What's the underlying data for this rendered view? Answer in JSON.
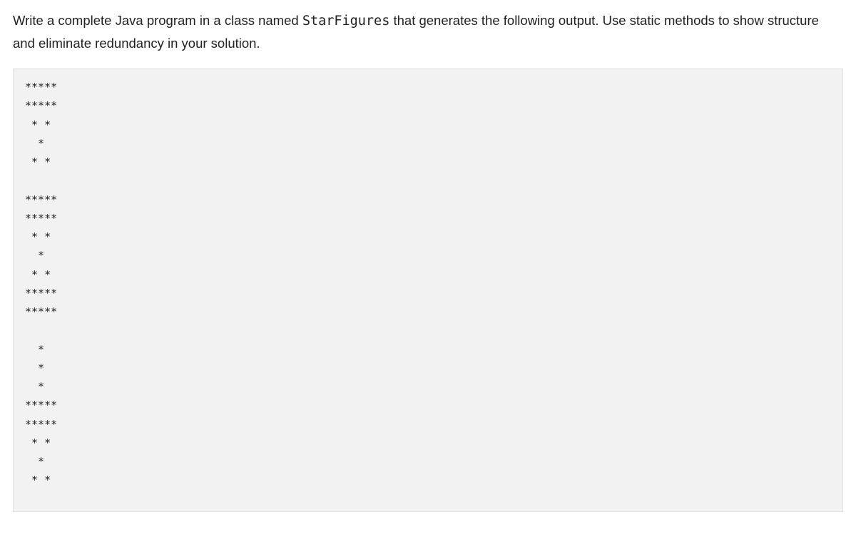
{
  "prompt": {
    "pre": "Write a complete Java program in a class named ",
    "class_name": "StarFigures",
    "post": " that generates the following output. Use static methods to show structure and eliminate redundancy in your solution."
  },
  "output": "*****\n*****\n * *\n  *\n * *\n\n*****\n*****\n * *\n  *\n * *\n*****\n*****\n\n  *\n  *\n  *\n*****\n*****\n * *\n  *\n * *"
}
